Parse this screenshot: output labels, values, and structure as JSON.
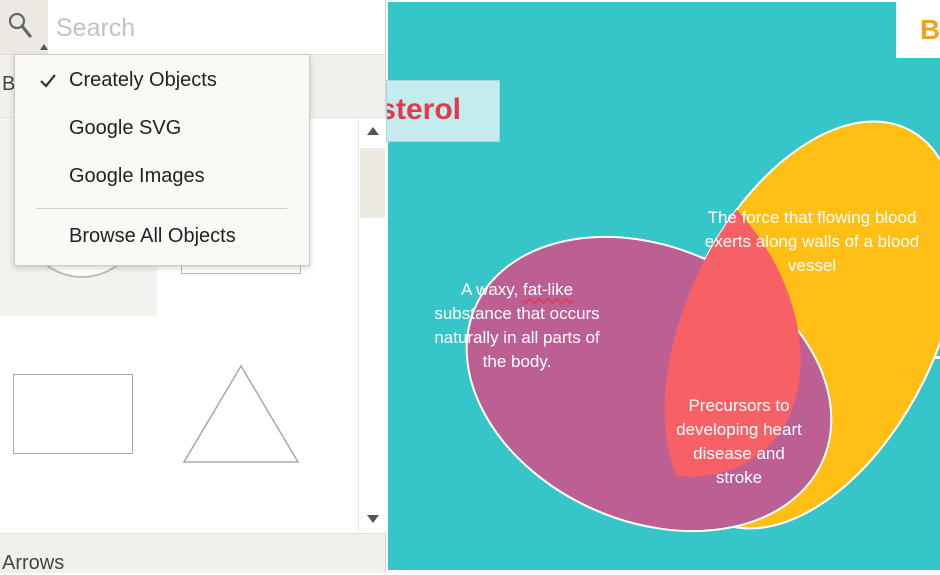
{
  "search": {
    "placeholder": "Search",
    "icon": "magnifier"
  },
  "library": {
    "current_category_partial": "B",
    "bottom_category": "Arrows"
  },
  "dropdown": {
    "items": [
      {
        "label": "Creately Objects",
        "checked": true
      },
      {
        "label": "Google SVG",
        "checked": false
      },
      {
        "label": "Google Images",
        "checked": false
      }
    ],
    "footer_item": {
      "label": "Browse All Objects"
    }
  },
  "canvas": {
    "title_visible": "sterol",
    "top_right_visible": "B",
    "background_color": "#36c5c8",
    "venn": {
      "yellow": {
        "color": "#ffbf14",
        "text": "The force that flowing blood exerts along walls of a blood vessel"
      },
      "purple": {
        "color": "#bc5f93",
        "text_line1_prefix": "A waxy, ",
        "text_line1_misspelled": "fat-like",
        "text_rest": "substance that occurs naturally in all parts of the body."
      },
      "overlap": {
        "color": "#f76165",
        "text": "Precursors to developing heart disease and stroke"
      }
    },
    "colors": {
      "title": "#e4384c",
      "top_right_text": "#f2a31b"
    }
  }
}
